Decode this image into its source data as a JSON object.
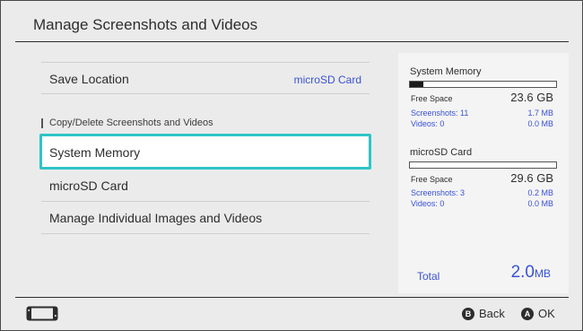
{
  "header": {
    "title": "Manage Screenshots and Videos"
  },
  "menu": {
    "save_location": {
      "label": "Save Location",
      "value": "microSD Card"
    },
    "section_label": "Copy/Delete Screenshots and Videos",
    "items": [
      {
        "label": "System Memory",
        "selected": true
      },
      {
        "label": "microSD Card"
      },
      {
        "label": "Manage Individual Images and Videos"
      }
    ]
  },
  "panel": {
    "system": {
      "title": "System Memory",
      "used_fraction": 0.09,
      "free_label": "Free Space",
      "free_value": "23.6 GB",
      "screenshots_label": "Screenshots: 11",
      "screenshots_value": "1.7 MB",
      "videos_label": "Videos: 0",
      "videos_value": "0.0 MB"
    },
    "sd": {
      "title": "microSD Card",
      "used_fraction": 0.0,
      "free_label": "Free Space",
      "free_value": "29.6 GB",
      "screenshots_label": "Screenshots: 3",
      "screenshots_value": "0.2 MB",
      "videos_label": "Videos: 0",
      "videos_value": "0.0 MB"
    },
    "total": {
      "label": "Total",
      "value": "2.0",
      "unit": "MB"
    }
  },
  "footer": {
    "back": {
      "key": "B",
      "label": "Back"
    },
    "ok": {
      "key": "A",
      "label": "OK"
    }
  },
  "colors": {
    "accent": "#2ec4c6",
    "link": "#3a52d6",
    "background": "#ebebeb"
  },
  "icons": {
    "console": "switch-console-icon"
  }
}
